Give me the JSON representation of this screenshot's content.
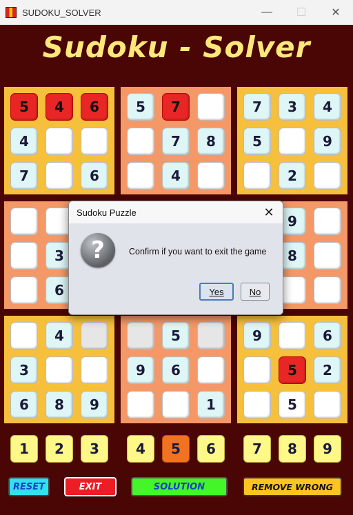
{
  "window": {
    "title": "SUDOKU_SOLVER",
    "minimize": "—",
    "maximize": "☐",
    "close": "✕"
  },
  "app": {
    "title": "Sudoku - Solver"
  },
  "boxes": [
    {
      "name": "top-left",
      "color": "#f7c03c",
      "cells": [
        {
          "v": "5",
          "s": "wrong"
        },
        {
          "v": "4",
          "s": "wrong"
        },
        {
          "v": "6",
          "s": "wrong"
        },
        {
          "v": "4",
          "s": "given"
        },
        {
          "v": "",
          "s": "blank"
        },
        {
          "v": "",
          "s": "blank"
        },
        {
          "v": "7",
          "s": "given"
        },
        {
          "v": "",
          "s": "blank"
        },
        {
          "v": "6",
          "s": "given"
        }
      ]
    },
    {
      "name": "top-middle",
      "color": "#f59868",
      "cells": [
        {
          "v": "5",
          "s": "given"
        },
        {
          "v": "7",
          "s": "wrong"
        },
        {
          "v": "",
          "s": "blank"
        },
        {
          "v": "",
          "s": "blank"
        },
        {
          "v": "7",
          "s": "given"
        },
        {
          "v": "8",
          "s": "given"
        },
        {
          "v": "",
          "s": "blank"
        },
        {
          "v": "4",
          "s": "given"
        },
        {
          "v": "",
          "s": "blank"
        }
      ]
    },
    {
      "name": "top-right",
      "color": "#f7c03c",
      "cells": [
        {
          "v": "7",
          "s": "given"
        },
        {
          "v": "3",
          "s": "given"
        },
        {
          "v": "4",
          "s": "given"
        },
        {
          "v": "5",
          "s": "given"
        },
        {
          "v": "",
          "s": "blank"
        },
        {
          "v": "9",
          "s": "given"
        },
        {
          "v": "",
          "s": "blank"
        },
        {
          "v": "2",
          "s": "given"
        },
        {
          "v": "",
          "s": "blank"
        }
      ]
    },
    {
      "name": "middle-left",
      "color": "#f59868",
      "cells": [
        {
          "v": "",
          "s": "blank"
        },
        {
          "v": "",
          "s": "blank"
        },
        {
          "v": "",
          "s": "blank"
        },
        {
          "v": "",
          "s": "blank"
        },
        {
          "v": "3",
          "s": "given"
        },
        {
          "v": "",
          "s": "blank"
        },
        {
          "v": "",
          "s": "blank"
        },
        {
          "v": "6",
          "s": "given"
        },
        {
          "v": "",
          "s": "blank"
        }
      ]
    },
    {
      "name": "middle-middle",
      "color": "#f7c03c",
      "cells": [
        {
          "v": "",
          "s": "blank"
        },
        {
          "v": "",
          "s": "blank"
        },
        {
          "v": "",
          "s": "blank"
        },
        {
          "v": "",
          "s": "blank"
        },
        {
          "v": "",
          "s": "blank"
        },
        {
          "v": "",
          "s": "blank"
        },
        {
          "v": "",
          "s": "blank"
        },
        {
          "v": "",
          "s": "blank"
        },
        {
          "v": "",
          "s": "blank"
        }
      ]
    },
    {
      "name": "middle-right",
      "color": "#f59868",
      "cells": [
        {
          "v": "",
          "s": "blank"
        },
        {
          "v": "9",
          "s": "given"
        },
        {
          "v": "",
          "s": "blank"
        },
        {
          "v": "",
          "s": "blank"
        },
        {
          "v": "8",
          "s": "given"
        },
        {
          "v": "",
          "s": "blank"
        },
        {
          "v": "",
          "s": "blank"
        },
        {
          "v": "",
          "s": "blank"
        },
        {
          "v": "",
          "s": "blank"
        }
      ]
    },
    {
      "name": "bottom-left",
      "color": "#f7c03c",
      "cells": [
        {
          "v": "",
          "s": "blank"
        },
        {
          "v": "4",
          "s": "given"
        },
        {
          "v": "",
          "s": "grey"
        },
        {
          "v": "3",
          "s": "given"
        },
        {
          "v": "",
          "s": "blank"
        },
        {
          "v": "",
          "s": "blank"
        },
        {
          "v": "6",
          "s": "given"
        },
        {
          "v": "8",
          "s": "given"
        },
        {
          "v": "9",
          "s": "given"
        }
      ]
    },
    {
      "name": "bottom-middle",
      "color": "#f59868",
      "cells": [
        {
          "v": "",
          "s": "grey"
        },
        {
          "v": "5",
          "s": "given"
        },
        {
          "v": "",
          "s": "grey"
        },
        {
          "v": "9",
          "s": "given"
        },
        {
          "v": "6",
          "s": "given"
        },
        {
          "v": "",
          "s": "blank"
        },
        {
          "v": "",
          "s": "blank"
        },
        {
          "v": "",
          "s": "blank"
        },
        {
          "v": "1",
          "s": "given"
        }
      ]
    },
    {
      "name": "bottom-right",
      "color": "#f7c03c",
      "cells": [
        {
          "v": "9",
          "s": "given"
        },
        {
          "v": "",
          "s": "blank"
        },
        {
          "v": "6",
          "s": "given"
        },
        {
          "v": "",
          "s": "blank"
        },
        {
          "v": "5",
          "s": "wrong"
        },
        {
          "v": "2",
          "s": "given"
        },
        {
          "v": "",
          "s": "blank"
        },
        {
          "v": "5",
          "s": "blank"
        },
        {
          "v": "",
          "s": "blank"
        }
      ]
    }
  ],
  "number_buttons": [
    {
      "label": "1",
      "active": false
    },
    {
      "label": "2",
      "active": false
    },
    {
      "label": "3",
      "active": false
    },
    {
      "label": "4",
      "active": false
    },
    {
      "label": "5",
      "active": true
    },
    {
      "label": "6",
      "active": false
    },
    {
      "label": "7",
      "active": false
    },
    {
      "label": "8",
      "active": false
    },
    {
      "label": "9",
      "active": false
    }
  ],
  "actions": {
    "reset": "RESET",
    "exit": "EXIT",
    "solution": "SOLUTION",
    "remove_wrong": "REMOVE WRONG"
  },
  "dialog": {
    "title": "Sudoku Puzzle",
    "close": "✕",
    "icon": "question-icon",
    "icon_glyph": "?",
    "message": "Confirm if you want to exit the game",
    "yes": "Yes",
    "no": "No"
  }
}
